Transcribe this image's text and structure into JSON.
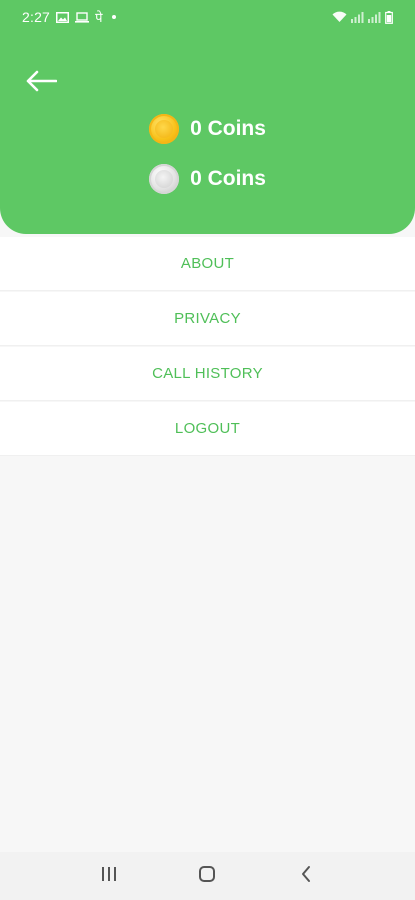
{
  "status_bar": {
    "time": "2:27",
    "hindi_glyph": "पे"
  },
  "coins": {
    "gold_text": "0 Coins",
    "silver_text": "0 Coins"
  },
  "menu": {
    "items": [
      {
        "label": "ABOUT"
      },
      {
        "label": "PRIVACY"
      },
      {
        "label": "CALL HISTORY"
      },
      {
        "label": "LOGOUT"
      }
    ]
  },
  "colors": {
    "header_green": "#5ec864",
    "menu_text_green": "#4fbf58",
    "gold": "#f8c21a",
    "silver": "#d6d6d6"
  },
  "icons": {
    "back": "arrow-left-icon",
    "gold_coin": "gold-coin-icon",
    "silver_coin": "silver-coin-icon",
    "nav_recents": "recents-icon",
    "nav_home": "home-icon",
    "nav_back": "nav-back-icon"
  }
}
